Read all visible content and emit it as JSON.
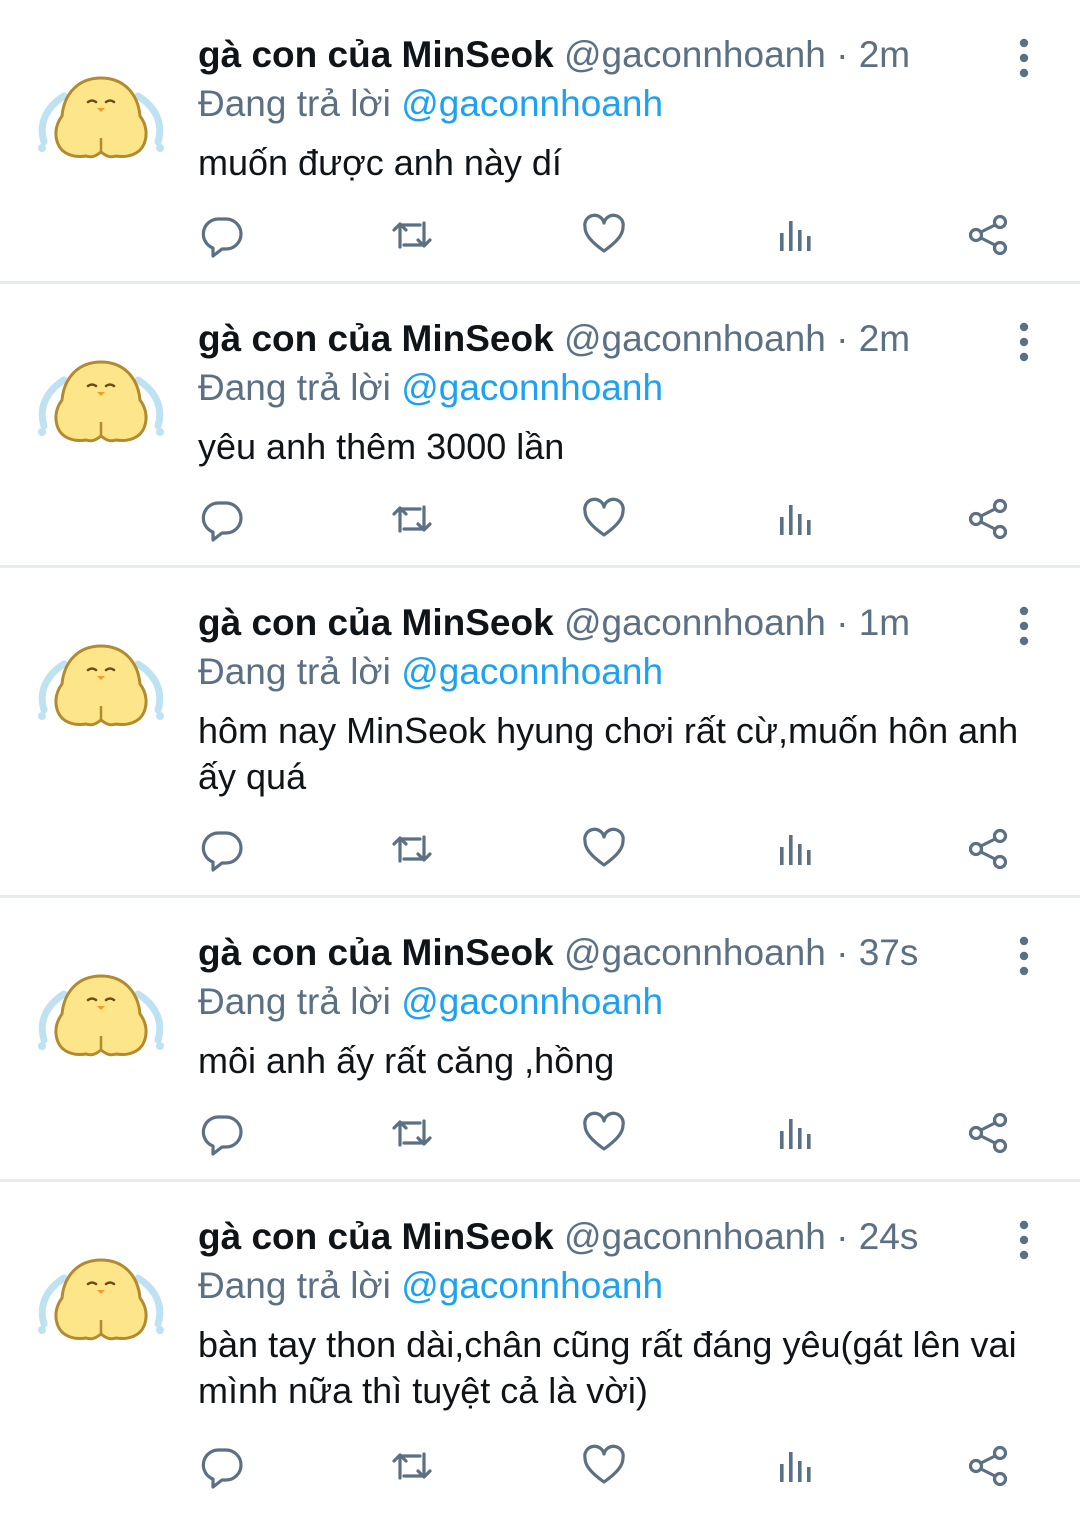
{
  "colors": {
    "text": "#0f1419",
    "secondary": "#5b7083",
    "accent": "#1da1f2",
    "divider": "#e6ecf0",
    "avatar_fill": "#fde58a",
    "avatar_tears": "#bfe2f3"
  },
  "icons": [
    "reply-icon",
    "retweet-icon",
    "like-icon",
    "analytics-icon",
    "share-icon",
    "more-options-icon"
  ],
  "tweets": [
    {
      "name": "gà con của MinSeok",
      "handle": "@gaconnhoanh",
      "sep": "·",
      "time": "2m",
      "reply_prefix": "Đang trả lời",
      "reply_to": "@gaconnhoanh",
      "text": "muốn được anh này dí"
    },
    {
      "name": "gà con của MinSeok",
      "handle": "@gaconnhoanh",
      "sep": "·",
      "time": "2m",
      "reply_prefix": "Đang trả lời",
      "reply_to": "@gaconnhoanh",
      "text": "yêu anh thêm 3000 lần"
    },
    {
      "name": "gà con của MinSeok",
      "handle": "@gaconnhoanh",
      "sep": "·",
      "time": "1m",
      "reply_prefix": "Đang trả lời",
      "reply_to": "@gaconnhoanh",
      "text": "hôm nay MinSeok hyung chơi rất cừ,muốn hôn anh ấy quá"
    },
    {
      "name": "gà con của MinSeok",
      "handle": "@gaconnhoanh",
      "sep": "·",
      "time": "37s",
      "reply_prefix": "Đang trả lời",
      "reply_to": "@gaconnhoanh",
      "text": "môi anh ấy rất căng ,hồng"
    },
    {
      "name": "gà con của MinSeok",
      "handle": "@gaconnhoanh",
      "sep": "·",
      "time": "24s",
      "reply_prefix": "Đang trả lời",
      "reply_to": "@gaconnhoanh",
      "text": "bàn tay thon dài,chân cũng rất đáng yêu(gát lên vai mình nữa thì tuyệt cả là vời)"
    }
  ]
}
